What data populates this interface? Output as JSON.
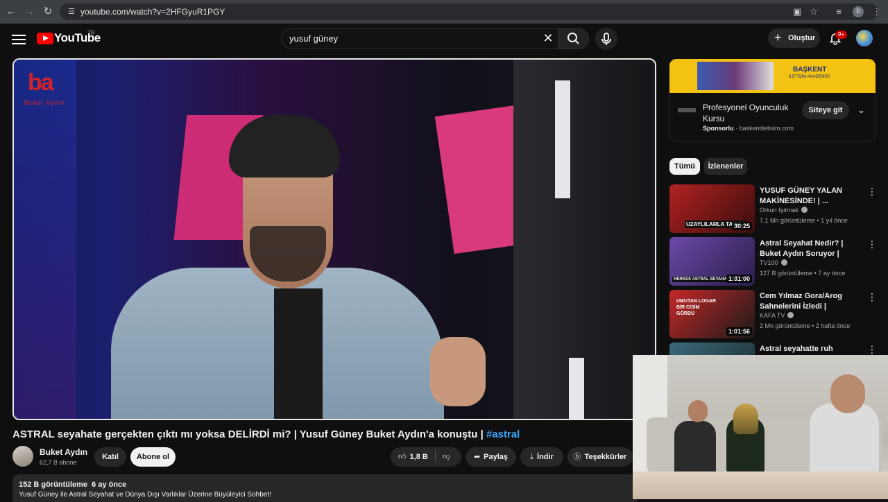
{
  "browser": {
    "url": "youtube.com/watch?v=2HFGyuR1PGY",
    "profile_initial": "b"
  },
  "header": {
    "logo_word": "YouTube",
    "logo_sup": "TR",
    "search_value": "yusuf güney",
    "create_label": "Oluştur",
    "notification_count": "9+"
  },
  "video": {
    "channel_watermark": "ba",
    "channel_watermark_sub": "Buket Aydın",
    "title_main": "ASTRAL seyahate gerçekten çıktı mı yoksa DELİRDİ mi? | Yusuf Güney Buket Aydın'a konuştu | ",
    "title_tag": "#astral"
  },
  "channel": {
    "name": "Buket Aydın",
    "subscribers": "62,7 B abone",
    "join_label": "Katıl",
    "subscribe_label": "Abone ol"
  },
  "actions": {
    "likes": "1,8 B",
    "share": "Paylaş",
    "download": "İndir",
    "thanks": "Teşekkürler"
  },
  "description": {
    "views": "152 B görüntüleme",
    "age": "6 ay önce",
    "text": "Yusuf Güney ile Astral Seyahat ve Dünya Dışı Varlıklar Üzerine Büyüleyici Sohbet!"
  },
  "ad": {
    "banner_text": "BAŞKENT",
    "banner_sub": "İLETİŞİM AKADEMİSİ",
    "title": "Profesyonel Oyunculuk Kursu",
    "sponsor_label": "Sponsorlu",
    "domain": "baskentiletisim.com",
    "cta": "Siteye git"
  },
  "chips": [
    "Tümü",
    "İzlenenler"
  ],
  "related": [
    {
      "title": "YUSUF GÜNEY YALAN MAKİNESİNDE! | ...",
      "channel": "Orkun Işıtmak",
      "views": "7,1 Mn görüntüleme",
      "age": "1 yıl önce",
      "duration": "30:25",
      "thumb_text": "UZAYLILARLA TANIŞT"
    },
    {
      "title": "Astral Seyahat Nedir? | Buket Aydın Soruyor | Yusuf Güney",
      "channel": "TV100",
      "views": "127 B görüntüleme",
      "age": "7 ay önce",
      "duration": "1:31:00",
      "thumb_text": "HERKES ASTRAL SEYAHATE ÇI"
    },
    {
      "title": "Cem Yılmaz Gora/Arog Sahnelerini İzledi | Fenomen ...",
      "channel": "KAFA TV",
      "views": "2 Mn görüntüleme",
      "age": "2 hafta önce",
      "duration": "1:01:56",
      "thumb_text": "UMUTAN LOGAR BİR CİSİM GÖRDÜ"
    },
    {
      "title": "Astral seyahatte ruh bedenden",
      "channel": "",
      "views": "",
      "age": "",
      "duration": "",
      "thumb_text": ""
    }
  ],
  "colors": {
    "accent": "#ff0000",
    "link": "#3ea6ff",
    "background": "#0f0f0f"
  }
}
